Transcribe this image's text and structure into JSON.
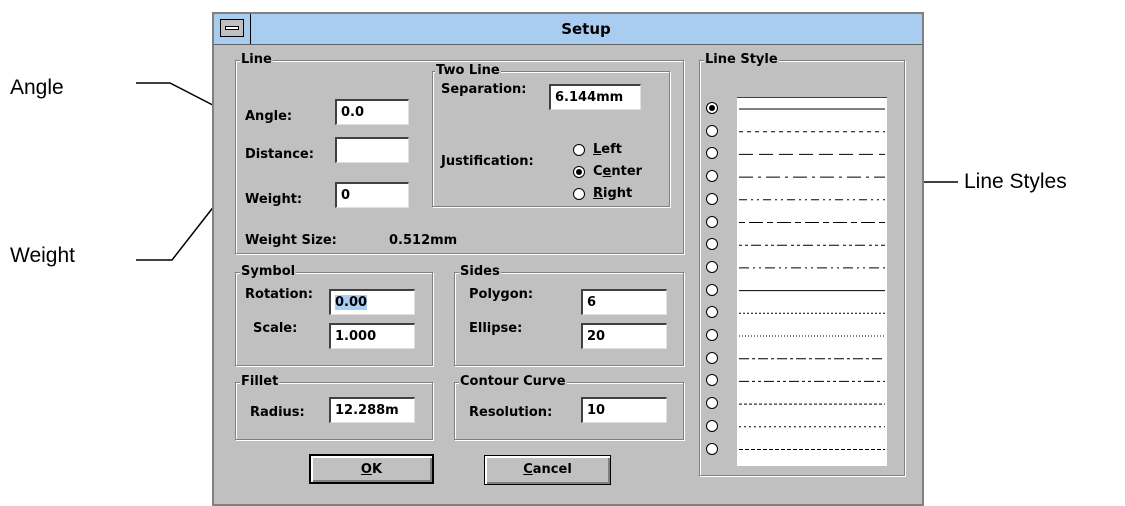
{
  "callouts": {
    "angle": "Angle",
    "weight": "Weight",
    "line_styles": "Line Styles"
  },
  "window": {
    "title": "Setup"
  },
  "line_group": {
    "label": "Line",
    "angle_label": "Angle:",
    "angle_value": "0.0",
    "distance_label": "Distance:",
    "distance_value": "",
    "weight_label": "Weight:",
    "weight_value": "0",
    "weight_size_label": "Weight Size:",
    "weight_size_value": "0.512mm"
  },
  "two_line_group": {
    "label": "Two Line",
    "separation_label": "Separation:",
    "separation_value": "6.144mm",
    "justification_label": "Justification:",
    "options": [
      {
        "pre": "",
        "key": "L",
        "post": "eft",
        "selected": false
      },
      {
        "pre": "C",
        "key": "e",
        "post": "nter",
        "selected": true
      },
      {
        "pre": "",
        "key": "R",
        "post": "ight",
        "selected": false
      }
    ]
  },
  "symbol_group": {
    "label": "Symbol",
    "rotation_label": "Rotation:",
    "rotation_value": "0.00",
    "scale_label": "Scale:",
    "scale_value": "1.000"
  },
  "sides_group": {
    "label": "Sides",
    "polygon_label": "Polygon:",
    "polygon_value": "6",
    "ellipse_label": "Ellipse:",
    "ellipse_value": "20"
  },
  "fillet_group": {
    "label": "Fillet",
    "radius_label": "Radius:",
    "radius_value": "12.288m"
  },
  "contour_group": {
    "label": "Contour Curve",
    "resolution_label": "Resolution:",
    "resolution_value": "10"
  },
  "buttons": {
    "ok_key": "O",
    "ok_rest": "K",
    "cancel_key": "C",
    "cancel_rest": "ancel"
  },
  "line_style_group": {
    "label": "Line Style",
    "styles": [
      {
        "dash": "none",
        "selected": true
      },
      {
        "dash": "4 4",
        "selected": false
      },
      {
        "dash": "14 6",
        "selected": false
      },
      {
        "dash": "14 5 3 5",
        "selected": false
      },
      {
        "dash": "8 4 2 4 2 4",
        "selected": false
      },
      {
        "dash": "6 4 14 4",
        "selected": false
      },
      {
        "dash": "3 3 3 3 10 4",
        "selected": false
      },
      {
        "dash": "10 4 2 4 2 4",
        "selected": false
      },
      {
        "dash": "none",
        "selected": false
      },
      {
        "dash": "2 2",
        "selected": false
      },
      {
        "dash": "1 2",
        "selected": false
      },
      {
        "dash": "10 3 3 3",
        "selected": false
      },
      {
        "dash": "10 3 3 3 3 3",
        "selected": false
      },
      {
        "dash": "3 2",
        "selected": false
      },
      {
        "dash": "2 3",
        "selected": false
      },
      {
        "dash": "4 2",
        "selected": false
      }
    ]
  }
}
